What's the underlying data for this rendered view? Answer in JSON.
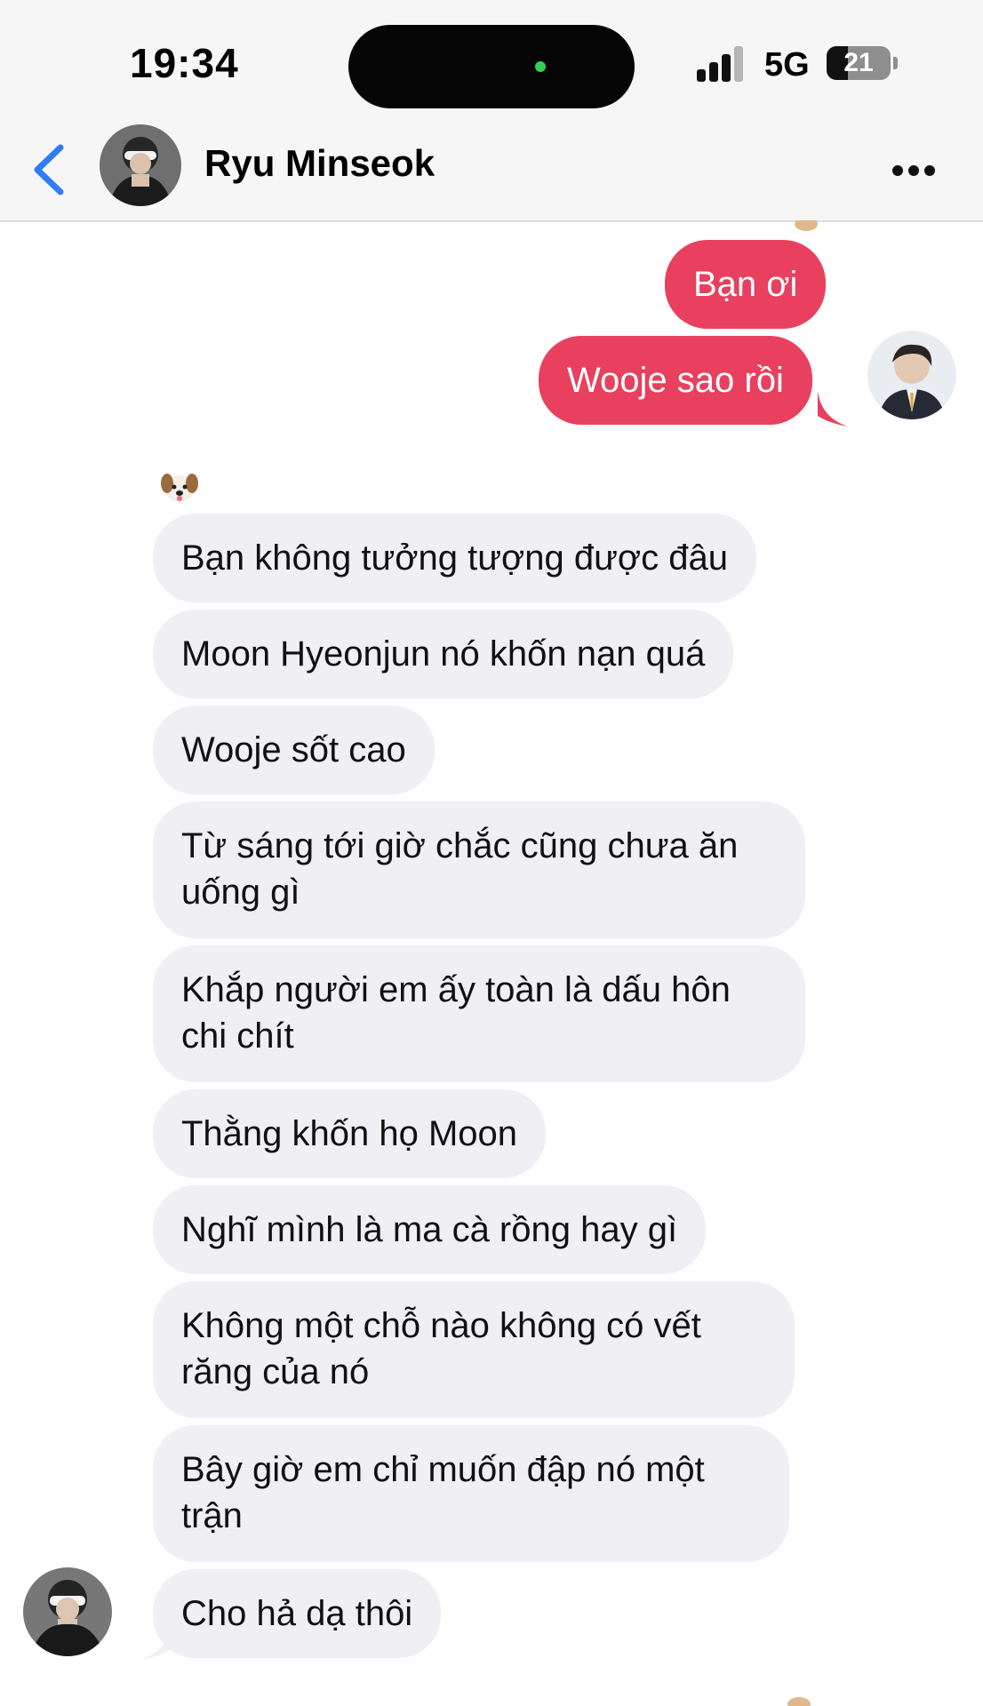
{
  "status_bar": {
    "time": "19:34",
    "network": "5G",
    "battery": "21"
  },
  "header": {
    "contact_name": "Ryu Minseok"
  },
  "messages": {
    "outgoing": [
      "Bạn ơi",
      "Wooje sao rồi"
    ],
    "incoming": [
      "Bạn không tưởng tượng được đâu",
      "Moon Hyeonjun nó khốn nạn quá",
      "Wooje sốt cao",
      "Từ sáng tới giờ chắc cũng chưa ăn uống gì",
      "Khắp người em ấy toàn là dấu hôn chi chít",
      "Thằng khốn họ Moon",
      "Nghĩ mình là ma cà rồng hay gì",
      "Không một chỗ nào không có vết răng của nó",
      "Bây giờ em chỉ muốn đập nó một trận",
      "Cho hả dạ thôi"
    ]
  },
  "colors": {
    "outgoing_bubble": "#e8405e",
    "incoming_bubble": "#efeff4",
    "accent": "#2f7cf6"
  },
  "icons": [
    "back-chevron-icon",
    "more-dots-icon",
    "dog-emoji-icon",
    "signal-bars-icon",
    "battery-icon"
  ]
}
